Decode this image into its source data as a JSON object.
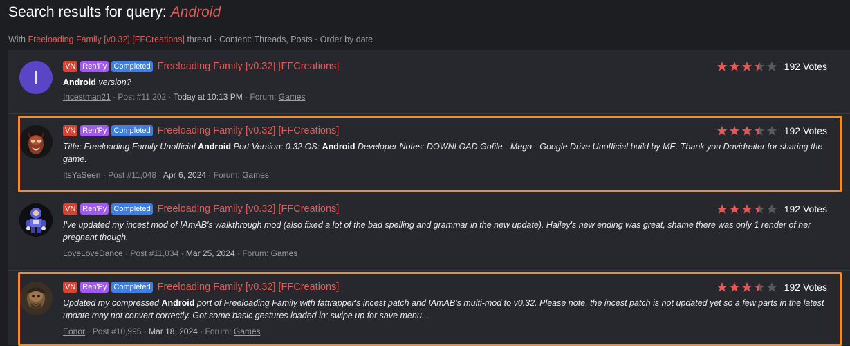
{
  "header": {
    "title_prefix": "Search results for query:",
    "query": "Android"
  },
  "filters": {
    "with_label": "With",
    "thread_link": "Freeloading Family [v0.32] [FFCreations]",
    "rest": "thread · Content: Threads, Posts · Order by date"
  },
  "colors": {
    "accent": "#e05a56",
    "highlight": "#ff8a1c",
    "tag_vn": "#d8432f",
    "tag_renpy": "#a259f1",
    "tag_completed": "#3f7fe3"
  },
  "results": [
    {
      "avatar": "I",
      "tags": [
        "VN",
        "Ren'Py",
        "Completed"
      ],
      "thread_title": "Freeloading Family [v0.32] [FFCreations]",
      "rating": 3.5,
      "votes": "192 Votes",
      "snippet_parts": [
        "Android",
        " version?"
      ],
      "author": "Incestman21",
      "post": "· Post #11,202 ·",
      "date": "Today at 10:13 PM",
      "forum_label": "· Forum:",
      "forum": "Games"
    },
    {
      "avatar_icon": "devil-face-avatar",
      "tags": [
        "VN",
        "Ren'Py",
        "Completed"
      ],
      "thread_title": "Freeloading Family [v0.32] [FFCreations]",
      "rating": 3.5,
      "votes": "192 Votes",
      "snippet_parts": [
        "Title: Freeloading Family Unofficial ",
        "Android",
        " Port Version: 0.32 OS: ",
        "Android",
        " Developer Notes: DOWNLOAD Gofile - Mega - Google Drive Unofficial build by ME. Thank you Davidreiter for sharing the game."
      ],
      "author": "ItsYaSeen",
      "post": "· Post #11,048 ·",
      "date": "Apr 6, 2024",
      "forum_label": "· Forum:",
      "forum": "Games"
    },
    {
      "avatar_icon": "robot-avatar",
      "tags": [
        "VN",
        "Ren'Py",
        "Completed"
      ],
      "thread_title": "Freeloading Family [v0.32] [FFCreations]",
      "rating": 3.5,
      "votes": "192 Votes",
      "snippet_parts": [
        "I've updated my incest mod of IAmAB's walkthrough mod (also fixed a lot of the bad spelling and grammar in the new update). Hailey's new ending was great, shame there was only 1 render of her pregnant though."
      ],
      "author": "LoveLoveDance",
      "post": "· Post #11,034 ·",
      "date": "Mar 25, 2024",
      "forum_label": "· Forum:",
      "forum": "Games"
    },
    {
      "avatar_icon": "warrior-avatar",
      "tags": [
        "VN",
        "Ren'Py",
        "Completed"
      ],
      "thread_title": "Freeloading Family [v0.32] [FFCreations]",
      "rating": 3.5,
      "votes": "192 Votes",
      "snippet_parts": [
        "Updated my compressed ",
        "Android",
        " port of Freeloading Family with fattrapper's incest patch and IAmAB's multi-mod to v0.32. Please note, the incest patch is not updated yet so a few parts in the latest update may not convert correctly. Got some basic gestures loaded in: swipe up for save menu..."
      ],
      "author": "Eonor",
      "post": "· Post #10,995 ·",
      "date": "Mar 18, 2024",
      "forum_label": "· Forum:",
      "forum": "Games"
    }
  ]
}
